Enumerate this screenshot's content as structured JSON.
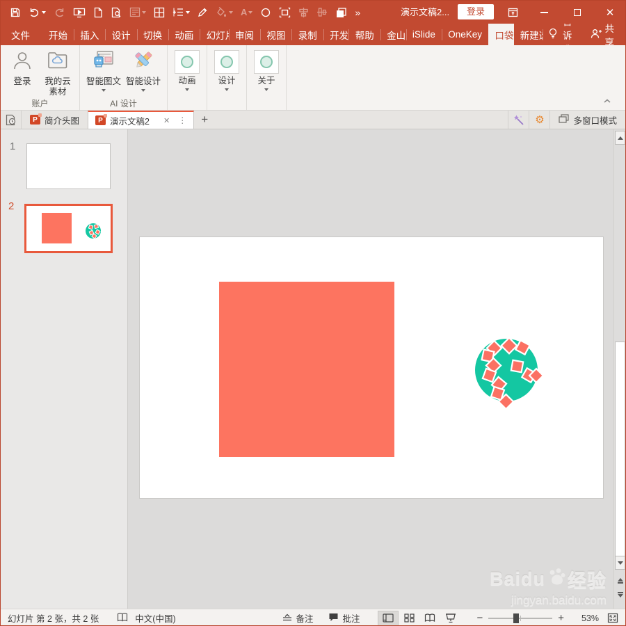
{
  "window": {
    "title": "演示文稿2...",
    "login_button": "登录"
  },
  "menu": {
    "tabs": [
      "文件",
      "开始",
      "插入",
      "设计",
      "切换",
      "动画",
      "幻灯片放映",
      "审阅",
      "视图",
      "录制",
      "开发工具",
      "帮助",
      "金山PDF",
      "iSlide",
      "OneKey",
      "口袋动画",
      "新建选项卡"
    ],
    "active_tab": "口袋动画",
    "tell_me_label": "告诉我",
    "share_label": "共享"
  },
  "ribbon": {
    "groups": [
      {
        "label": "账户",
        "buttons": [
          "登录",
          "我的云素材"
        ]
      },
      {
        "label": "AI 设计",
        "buttons": [
          "智能图文",
          "智能设计"
        ]
      },
      {
        "label": "",
        "buttons": [
          "动画"
        ]
      },
      {
        "label": "",
        "buttons": [
          "设计"
        ]
      },
      {
        "label": "",
        "buttons": [
          "关于"
        ]
      }
    ]
  },
  "doc_tabs": {
    "tabs": [
      "简介头图",
      "演示文稿2"
    ],
    "active": "演示文稿2",
    "multi_window_label": "多窗口模式"
  },
  "slide_panel": {
    "slides": [
      {
        "number": "1",
        "selected": false
      },
      {
        "number": "2",
        "selected": true
      }
    ]
  },
  "statusbar": {
    "slide_info": "幻灯片 第 2 张，共 2 张",
    "language": "中文(中国)",
    "notes_label": "备注",
    "comments_label": "批注",
    "zoom_level": "53%"
  },
  "watermark": {
    "brand": "Baidu",
    "brand_cn": "经验",
    "url": "jingyan.baidu.com"
  },
  "icons": {
    "more_chevron": "»",
    "close_tab": "✕",
    "kebab": "⋮",
    "new_tab": "+",
    "gear": "⚙",
    "close_window": "✕",
    "collapse_ribbon": "⌃",
    "zoom_out": "−",
    "zoom_in": "+"
  },
  "colors": {
    "titlebar": "#C24A31",
    "accent": "#E8593C",
    "coral": "#FD7460",
    "teal": "#14C7A2"
  }
}
